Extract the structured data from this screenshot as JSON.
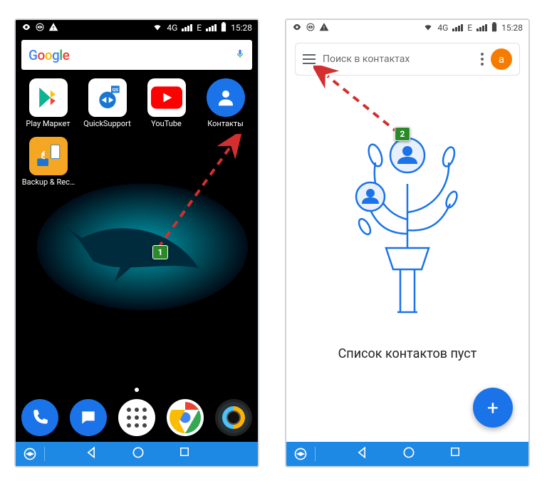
{
  "status": {
    "network_label": "4G",
    "extra_label": "E",
    "time": "15:28"
  },
  "home": {
    "search_logo": "Google",
    "apps": [
      {
        "label": "Play Маркет"
      },
      {
        "label": "QuickSupport"
      },
      {
        "label": "YouTube"
      },
      {
        "label": "Контакты"
      },
      {
        "label": "Backup & Rec…"
      }
    ]
  },
  "contacts": {
    "search_placeholder": "Поиск в контактах",
    "avatar_letter": "a",
    "empty_message": "Список контактов пуст",
    "fab_label": "+"
  },
  "annotation": {
    "badge1": "1",
    "badge2": "2"
  }
}
